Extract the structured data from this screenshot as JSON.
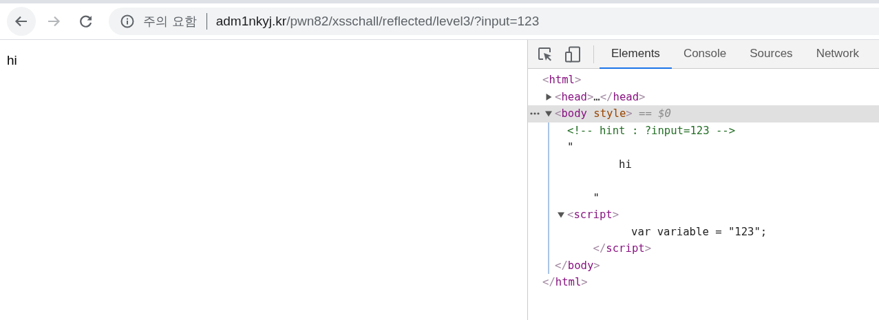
{
  "browser": {
    "nav_buttons": [
      {
        "kind": "back",
        "disabled": false
      },
      {
        "kind": "forward",
        "disabled": true
      },
      {
        "kind": "reload",
        "disabled": false
      }
    ],
    "address_bar": {
      "security_label": "주의 요함",
      "host": "adm1nkyj.kr",
      "path": "/pwn82/xsschall/reflected/level3/?input=123"
    }
  },
  "page": {
    "text": "hi"
  },
  "devtools": {
    "tabs": [
      {
        "label": "Elements",
        "selected": true
      },
      {
        "label": "Console",
        "selected": false
      },
      {
        "label": "Sources",
        "selected": false
      },
      {
        "label": "Network",
        "selected": false
      }
    ],
    "dom_tree": [
      {
        "kind": "element",
        "selected": false,
        "open": [
          {
            "kind": "punct",
            "text": "<"
          },
          {
            "kind": "tag",
            "text": "html"
          },
          {
            "kind": "punct",
            "text": ">"
          }
        ],
        "close": [
          {
            "kind": "punct",
            "text": "</"
          },
          {
            "kind": "tag",
            "text": "html"
          },
          {
            "kind": "punct",
            "text": ">"
          }
        ],
        "children": [
          {
            "kind": "element",
            "expanded": false,
            "selected": false,
            "open": [
              {
                "kind": "punct",
                "text": "<"
              },
              {
                "kind": "tag",
                "text": "head"
              },
              {
                "kind": "punct",
                "text": ">"
              },
              {
                "kind": "ellipsis",
                "text": "…"
              }
            ],
            "close": [
              {
                "kind": "punct",
                "text": "</"
              },
              {
                "kind": "tag",
                "text": "head"
              },
              {
                "kind": "punct",
                "text": ">"
              }
            ]
          },
          {
            "kind": "element",
            "expanded": true,
            "selected": true,
            "selection_label": "== $0",
            "open": [
              {
                "kind": "punct",
                "text": "<"
              },
              {
                "kind": "tag",
                "text": "body"
              },
              {
                "kind": "attr",
                "text": " style"
              },
              {
                "kind": "punct",
                "text": ">"
              }
            ],
            "close": [
              {
                "kind": "punct",
                "text": "</"
              },
              {
                "kind": "tag",
                "text": "body"
              },
              {
                "kind": "punct",
                "text": ">"
              }
            ],
            "children": [
              {
                "kind": "comment",
                "text": "<!-- hint : ?input=123 -->"
              },
              {
                "kind": "text",
                "text": "\"\n        hi\n\n    \""
              },
              {
                "kind": "element",
                "expanded": true,
                "selected": false,
                "open": [
                  {
                    "kind": "punct",
                    "text": "<"
                  },
                  {
                    "kind": "tag",
                    "text": "script"
                  },
                  {
                    "kind": "punct",
                    "text": ">"
                  }
                ],
                "close": [
                  {
                    "kind": "punct",
                    "text": "</"
                  },
                  {
                    "kind": "tag",
                    "text": "script"
                  },
                  {
                    "kind": "punct",
                    "text": ">"
                  }
                ],
                "children": [
                  {
                    "kind": "text",
                    "text": "        var variable = \"123\";"
                  }
                ]
              }
            ]
          }
        ]
      }
    ]
  }
}
